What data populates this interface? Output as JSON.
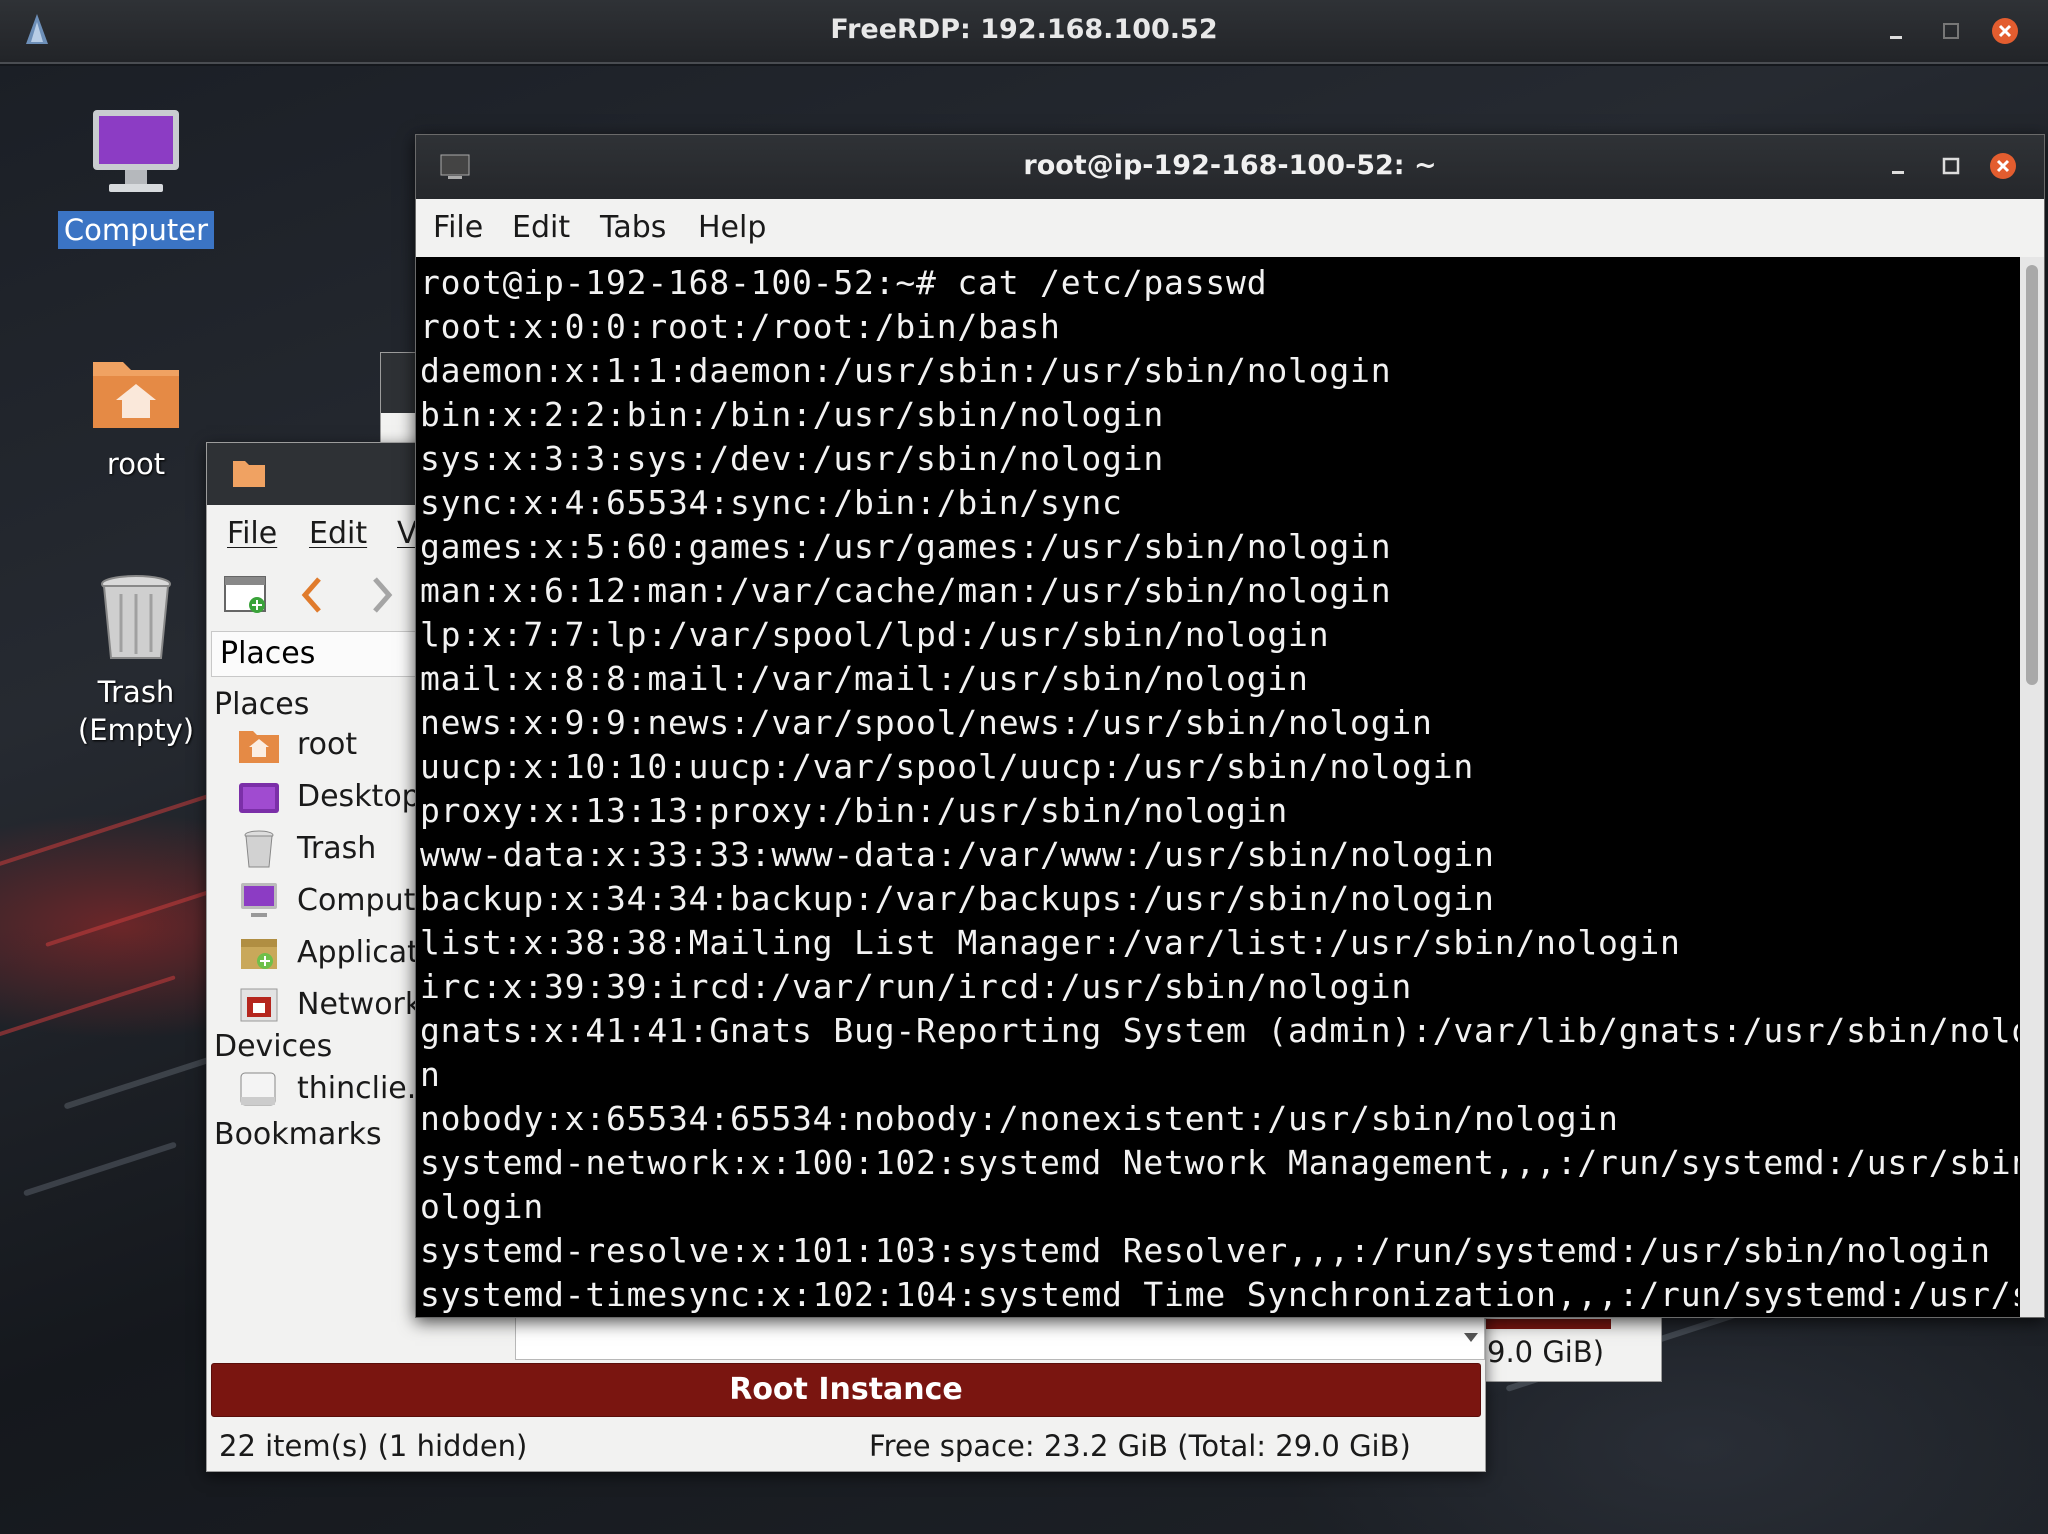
{
  "rdp": {
    "title": "FreeRDP: 192.168.100.52"
  },
  "desktop": {
    "icons": [
      {
        "label": "Computer"
      },
      {
        "label": "root"
      },
      {
        "label": "Trash",
        "sublabel": "(Empty)"
      }
    ]
  },
  "file_manager": {
    "menu": {
      "file": "File",
      "edit": "Edit",
      "view": "V"
    },
    "places_header": "Places",
    "sections": {
      "places": "Places",
      "devices": "Devices",
      "bookmarks": "Bookmarks"
    },
    "places": [
      {
        "label": "root",
        "icon": "home-folder-icon"
      },
      {
        "label": "Desktop",
        "icon": "desktop-icon"
      },
      {
        "label": "Trash",
        "icon": "trash-icon"
      },
      {
        "label": "Comput",
        "icon": "computer-icon"
      },
      {
        "label": "Applicat",
        "icon": "applications-icon"
      },
      {
        "label": "Network",
        "icon": "network-icon"
      }
    ],
    "devices": [
      {
        "label": "thinclie...",
        "icon": "drive-icon"
      }
    ],
    "root_banner": "Root Instance",
    "status_items": "22 item(s) (1 hidden)",
    "status_free": "Free space: 23.2 GiB (Total: 29.0 GiB)",
    "back_window_status": "9.0 GiB)"
  },
  "terminal": {
    "title": "root@ip-192-168-100-52: ~",
    "menu": {
      "file": "File",
      "edit": "Edit",
      "tabs": "Tabs",
      "help": "Help"
    },
    "lines": [
      "root@ip-192-168-100-52:~# cat /etc/passwd",
      "root:x:0:0:root:/root:/bin/bash",
      "daemon:x:1:1:daemon:/usr/sbin:/usr/sbin/nologin",
      "bin:x:2:2:bin:/bin:/usr/sbin/nologin",
      "sys:x:3:3:sys:/dev:/usr/sbin/nologin",
      "sync:x:4:65534:sync:/bin:/bin/sync",
      "games:x:5:60:games:/usr/games:/usr/sbin/nologin",
      "man:x:6:12:man:/var/cache/man:/usr/sbin/nologin",
      "lp:x:7:7:lp:/var/spool/lpd:/usr/sbin/nologin",
      "mail:x:8:8:mail:/var/mail:/usr/sbin/nologin",
      "news:x:9:9:news:/var/spool/news:/usr/sbin/nologin",
      "uucp:x:10:10:uucp:/var/spool/uucp:/usr/sbin/nologin",
      "proxy:x:13:13:proxy:/bin:/usr/sbin/nologin",
      "www-data:x:33:33:www-data:/var/www:/usr/sbin/nologin",
      "backup:x:34:34:backup:/var/backups:/usr/sbin/nologin",
      "list:x:38:38:Mailing List Manager:/var/list:/usr/sbin/nologin",
      "irc:x:39:39:ircd:/var/run/ircd:/usr/sbin/nologin",
      "gnats:x:41:41:Gnats Bug-Reporting System (admin):/var/lib/gnats:/usr/sbin/nologi",
      "n",
      "nobody:x:65534:65534:nobody:/nonexistent:/usr/sbin/nologin",
      "systemd-network:x:100:102:systemd Network Management,,,:/run/systemd:/usr/sbin/n",
      "ologin",
      "systemd-resolve:x:101:103:systemd Resolver,,,:/run/systemd:/usr/sbin/nologin",
      "systemd-timesync:x:102:104:systemd Time Synchronization,,,:/run/systemd:/usr/sbi"
    ]
  }
}
